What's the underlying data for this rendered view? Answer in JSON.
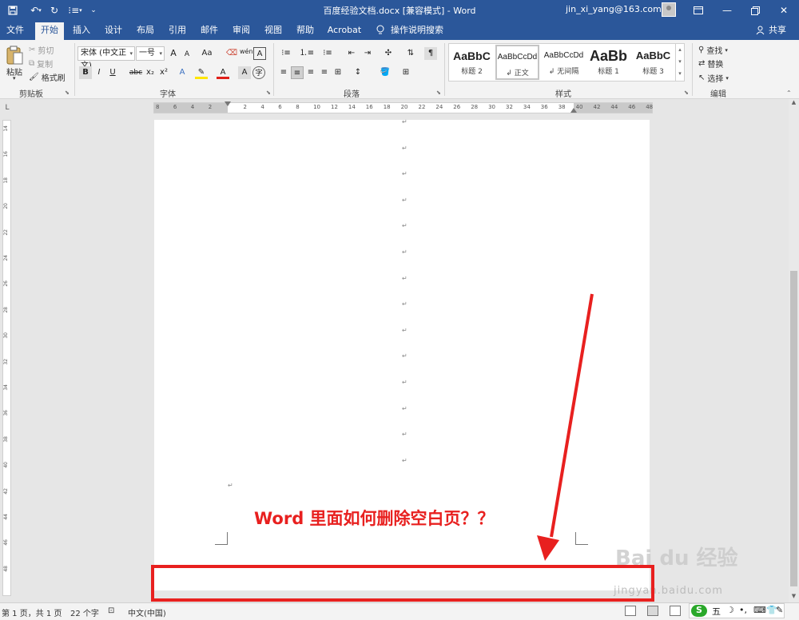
{
  "titlebar": {
    "title": "百度经验文档.docx [兼容模式]  -  Word",
    "user": "jin_xi_yang@163.com",
    "quick_access": {
      "save": "save-icon",
      "undo": "undo-icon",
      "redo": "redo-icon",
      "more": "customize-icon"
    }
  },
  "tabs": [
    {
      "label": "文件"
    },
    {
      "label": "开始",
      "active": true
    },
    {
      "label": "插入"
    },
    {
      "label": "设计"
    },
    {
      "label": "布局"
    },
    {
      "label": "引用"
    },
    {
      "label": "邮件"
    },
    {
      "label": "审阅"
    },
    {
      "label": "视图"
    },
    {
      "label": "帮助"
    },
    {
      "label": "Acrobat"
    },
    {
      "label": "操作说明搜索"
    }
  ],
  "share_label": "共享",
  "ribbon": {
    "clipboard": {
      "paste": "粘贴",
      "cut": "剪切",
      "copy": "复制",
      "format_painter": "格式刷",
      "group": "剪贴板"
    },
    "font": {
      "font_name": "宋体 (中文正文)",
      "font_size": "一号",
      "grow": "A",
      "shrink": "A",
      "change_case": "Aa",
      "bold": "B",
      "italic": "I",
      "underline": "U",
      "strike": "abc",
      "subscript": "x₂",
      "superscript": "x²",
      "group": "字体"
    },
    "paragraph": {
      "group": "段落"
    },
    "styles": {
      "items": [
        {
          "sample": "AaBbC",
          "name": "标题 2"
        },
        {
          "sample": "AaBbCcDd",
          "name": "↲ 正文"
        },
        {
          "sample": "AaBbCcDd",
          "name": "↲ 无间隔"
        },
        {
          "sample": "AaBb",
          "name": "标题 1"
        },
        {
          "sample": "AaBbC",
          "name": "标题 3"
        }
      ],
      "group": "样式"
    },
    "editing": {
      "find": "查找",
      "replace": "替换",
      "select": "选择",
      "group": "编辑"
    }
  },
  "ruler": {
    "h_ticks": [
      "8",
      "6",
      "4",
      "2",
      "",
      "2",
      "4",
      "6",
      "8",
      "10",
      "12",
      "14",
      "16",
      "18",
      "20",
      "22",
      "24",
      "26",
      "28",
      "30",
      "32",
      "34",
      "36",
      "38",
      "40",
      "42",
      "44",
      "46",
      "48"
    ],
    "v_ticks": [
      "14",
      "16",
      "18",
      "20",
      "22",
      "24",
      "26",
      "28",
      "30",
      "32",
      "34",
      "36",
      "38",
      "40",
      "42",
      "44",
      "46",
      "48"
    ]
  },
  "document": {
    "headline": "Word 里面如何删除空白页？？",
    "para_mark": "↵"
  },
  "watermark": {
    "main": "Bai du 经验",
    "sub": "jingyan.baidu.com"
  },
  "statusbar": {
    "page": "第 1 页，共 1 页",
    "words": "22 个字",
    "language": "中文(中国)"
  },
  "ime": {
    "label": "五"
  },
  "colors": {
    "brand": "#2b579a",
    "annotation": "#e8201f",
    "ribbon_bg": "#f3f3f3"
  }
}
